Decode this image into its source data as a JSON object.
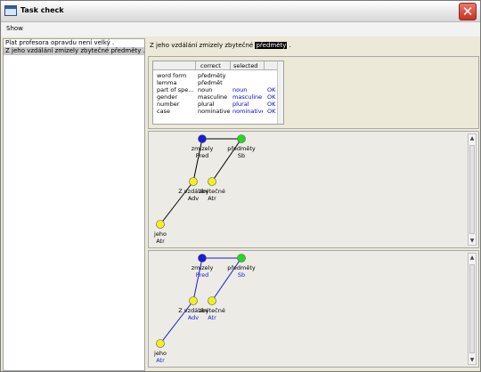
{
  "window": {
    "title": "Task check"
  },
  "menu": {
    "show": "Show"
  },
  "sentences": [
    {
      "text": "Plat profesora opravdu není velký ."
    },
    {
      "text": "Z jeho vzdálání zmizely zbytečné předměty ."
    }
  ],
  "current_sentence": {
    "before": "Z jeho vzdálání zmizely zbytečné ",
    "highlight": "předměty",
    "after": " ."
  },
  "feature_table": {
    "headers": {
      "feature": "",
      "correct": "correct",
      "selected": "selected",
      "ok": ""
    },
    "rows": [
      {
        "feature": "word form",
        "correct": "předměty",
        "selected": "",
        "ok": ""
      },
      {
        "feature": "lemma",
        "correct": "předmět",
        "selected": "",
        "ok": ""
      },
      {
        "feature": "part of spe...",
        "correct": "noun",
        "selected": "noun",
        "ok": "OK"
      },
      {
        "feature": "gender",
        "correct": "masculine",
        "selected": "masculine",
        "ok": "OK"
      },
      {
        "feature": "number",
        "correct": "plural",
        "selected": "plural",
        "ok": "OK"
      },
      {
        "feature": "case",
        "correct": "nominative",
        "selected": "nominative",
        "ok": "OK"
      }
    ]
  },
  "trees": [
    {
      "label_color": "#000000",
      "edge_color": "#000000",
      "nodes": [
        {
          "word": "zmizely",
          "func": "Pred",
          "color": "#1a1ad8"
        },
        {
          "word": "předměty",
          "func": "Sb",
          "color": "#22d822"
        },
        {
          "word": "Z vzdálání",
          "func": "Adv",
          "color": "#f0f020"
        },
        {
          "word": "zbytečné",
          "func": "Atr",
          "color": "#f0f020"
        },
        {
          "word": "jeho",
          "func": "Atr",
          "color": "#f0f020"
        }
      ]
    },
    {
      "label_color": "#1a1ad8",
      "edge_color": "#1a1ad8",
      "nodes": [
        {
          "word": "zmizely",
          "func": "Pred",
          "color": "#1a1ad8"
        },
        {
          "word": "předměty",
          "func": "Sb",
          "color": "#22d822"
        },
        {
          "word": "Z vzdálání",
          "func": "Adv",
          "color": "#f0f020"
        },
        {
          "word": "zbytečné",
          "func": "Atr",
          "color": "#f0f020"
        },
        {
          "word": "jeho",
          "func": "Atr",
          "color": "#f0f020"
        }
      ]
    }
  ],
  "colors": {
    "close_button": "#c8321f",
    "selection": "#c9c9c9"
  }
}
